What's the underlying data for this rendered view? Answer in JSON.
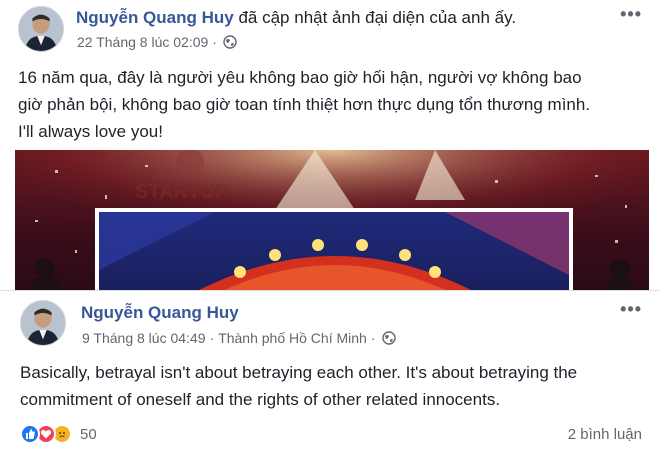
{
  "post1": {
    "author": "Nguyễn Quang Huy",
    "action": "đã cập nhật ảnh đại diện của anh ấy.",
    "date": "22 Tháng 8 lúc 02:09",
    "dot": "·",
    "privacy_icon": "globe-icon",
    "more_label": "•••",
    "text_lines": [
      "16 năm qua, đây là người yêu không bao giờ hối hận, người vợ không bao",
      "giờ phản bội, không bao giờ toan tính thiệt hơn thực dụng tổn thương mình.",
      "I'll always love you!"
    ]
  },
  "post2": {
    "author": "Nguyễn Quang Huy",
    "date": "9 Tháng 8 lúc 04:49",
    "dot": "·",
    "location": "Thành phố Hồ Chí Minh",
    "privacy_icon": "globe-icon",
    "more_label": "•••",
    "text_lines": [
      "Basically, betrayal isn't about betraying each other. It's about betraying the",
      "commitment of oneself and the rights of other related innocents."
    ],
    "reactions": {
      "icons": [
        "like-icon",
        "love-icon",
        "sad-icon"
      ],
      "count": "50"
    },
    "comments_label": "2 bình luận"
  },
  "colors": {
    "author_link": "#365899",
    "meta_text": "#616770",
    "like": "#1877f2",
    "love": "#f33e58",
    "sad": "#f7b125"
  }
}
